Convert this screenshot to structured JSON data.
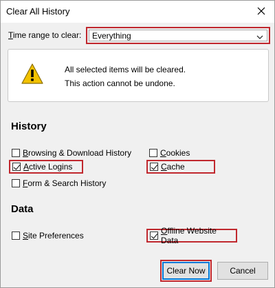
{
  "window": {
    "title": "Clear All History"
  },
  "time_range": {
    "label_accel": "T",
    "label_rest": "ime range to clear:",
    "selected": "Everything"
  },
  "warning": {
    "line1": "All selected items will be cleared.",
    "line2": "This action cannot be undone."
  },
  "history": {
    "heading": "History",
    "items": [
      {
        "accel": "B",
        "rest": "rowsing & Download History",
        "checked": false
      },
      {
        "accel": "C",
        "rest": "ookies",
        "checked": false
      },
      {
        "accel": "A",
        "rest": "ctive Logins",
        "checked": true
      },
      {
        "accel": "C",
        "rest": "ache",
        "checked": true
      },
      {
        "accel": "F",
        "rest": "orm & Search History",
        "checked": false
      }
    ]
  },
  "data": {
    "heading": "Data",
    "items": [
      {
        "accel": "S",
        "rest": "ite Preferences",
        "checked": false
      },
      {
        "accel": "O",
        "rest": "ffline Website Data",
        "checked": true
      }
    ]
  },
  "buttons": {
    "clear_now": "Clear Now",
    "cancel": "Cancel"
  },
  "colors": {
    "highlight": "#c0272d",
    "focus": "#0078d7",
    "warning_icon": "#f2c200"
  }
}
